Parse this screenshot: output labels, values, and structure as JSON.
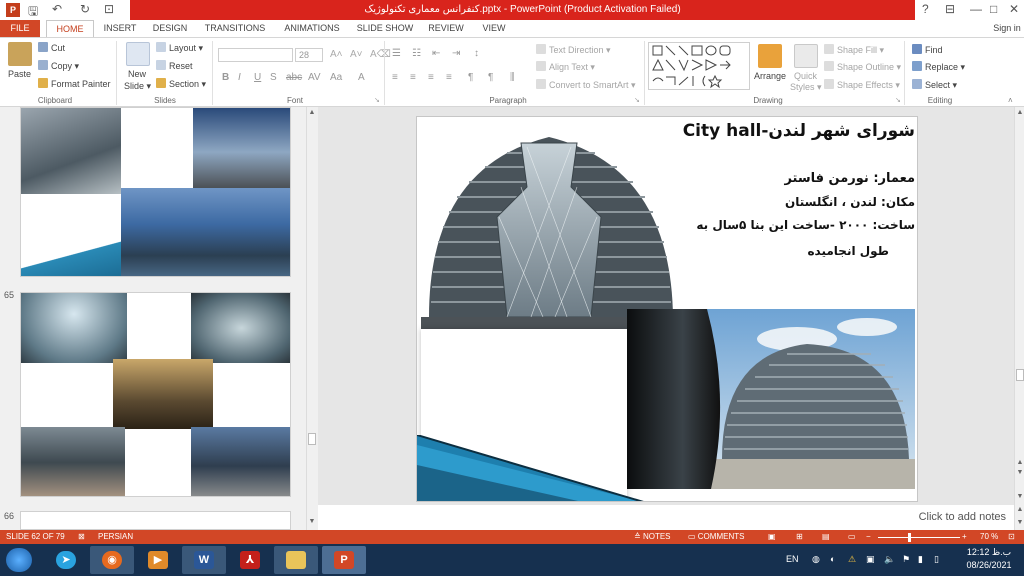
{
  "titlebar": {
    "title": "کنفرانس معماری تکنولوژیک.pptx - PowerPoint (Product Activation Failed)",
    "help": "?",
    "minimize": "—",
    "restore": "□",
    "close": "✕"
  },
  "tabs": [
    "FILE",
    "HOME",
    "INSERT",
    "DESIGN",
    "TRANSITIONS",
    "ANIMATIONS",
    "SLIDE SHOW",
    "REVIEW",
    "VIEW"
  ],
  "sign_in": "Sign in",
  "ribbon": {
    "clipboard": {
      "label": "Clipboard",
      "paste": "Paste",
      "cut": "Cut",
      "copy": "Copy",
      "format_painter": "Format Painter"
    },
    "slides": {
      "label": "Slides",
      "new_slide": "New",
      "new_slide2": "Slide",
      "layout": "Layout",
      "reset": "Reset",
      "section": "Section"
    },
    "font": {
      "label": "Font",
      "size": "28"
    },
    "paragraph": {
      "label": "Paragraph",
      "text_direction": "Text Direction",
      "align_text": "Align Text",
      "convert": "Convert to SmartArt"
    },
    "drawing": {
      "label": "Drawing",
      "arrange": "Arrange",
      "quick_styles": "Quick",
      "quick_styles2": "Styles",
      "shape_fill": "Shape Fill",
      "shape_outline": "Shape Outline",
      "shape_effects": "Shape Effects"
    },
    "editing": {
      "label": "Editing",
      "find": "Find",
      "replace": "Replace",
      "select": "Select"
    }
  },
  "thumbnails": {
    "n65": "65",
    "n66": "66"
  },
  "slide": {
    "title": "شورای شهر لندن-City hall",
    "line1": "معمار: نورمن فاستر",
    "line2": "مکان: لندن ، انگلستان",
    "line3": "ساخت: ۲۰۰۰ -ساخت این بنا ۵سال به",
    "line4": "طول انجامیده"
  },
  "notes_placeholder": "Click to add notes",
  "status": {
    "slide_of": "SLIDE 62 OF 79",
    "language": "PERSIAN",
    "notes": "NOTES",
    "comments": "COMMENTS",
    "zoom": "70 %"
  },
  "tray": {
    "lang": "EN",
    "time": "12:12 ب.ظ",
    "date": "08/26/2021"
  },
  "colors": {
    "accent": "#d24726",
    "title_red": "#d9241c",
    "taskbar": "#16304f"
  }
}
